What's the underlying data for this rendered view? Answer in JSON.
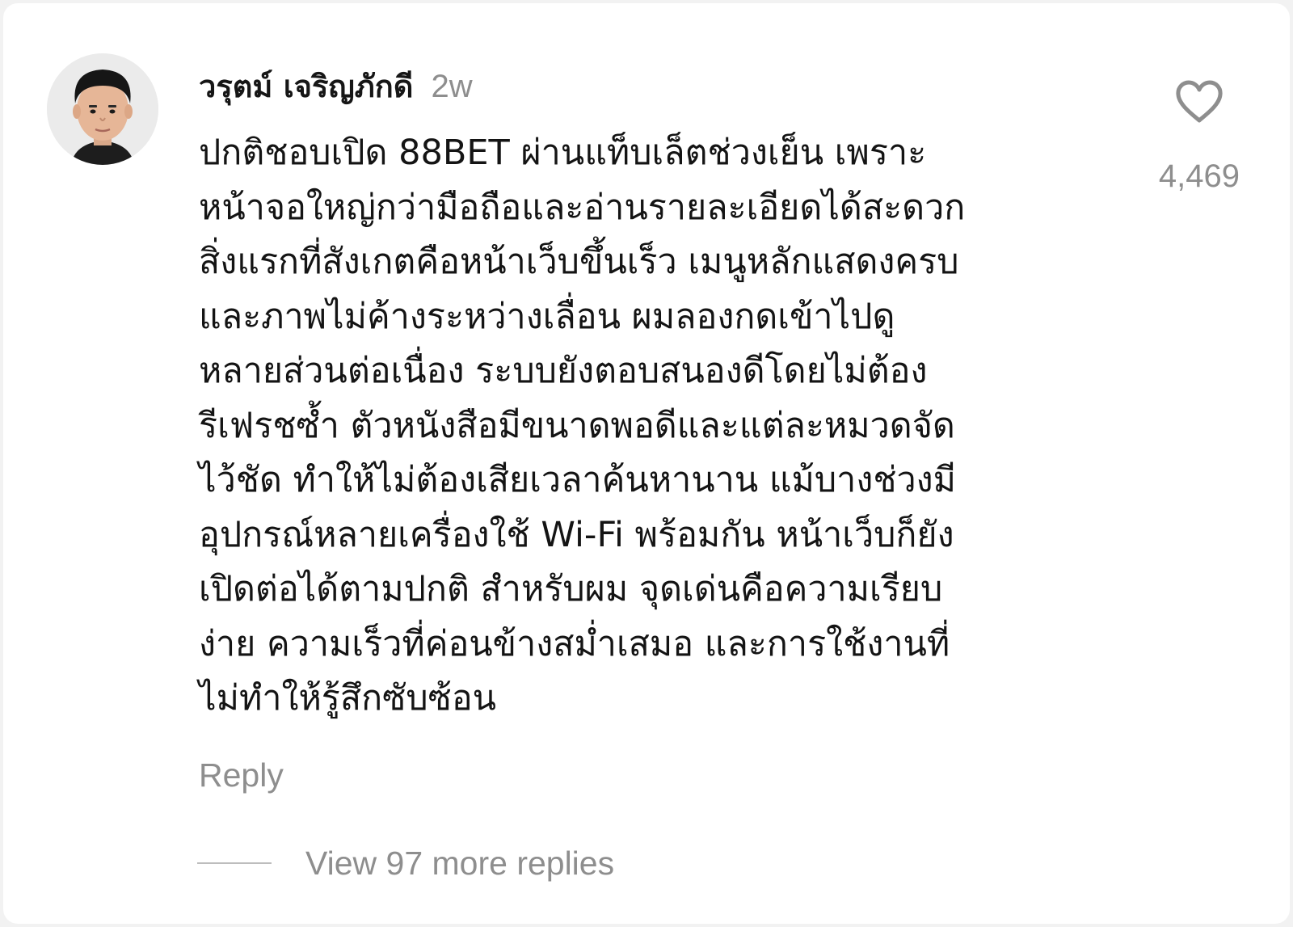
{
  "comment": {
    "username": "วรุตม์ เจริญภักดี",
    "time": "2w",
    "text_lines": [
      "ปกติชอบเปิด 88BET ผ่านแท็บเล็ตช่วงเย็น เพราะ",
      "หน้าจอใหญ่กว่ามือถือและอ่านรายละเอียดได้สะดวก",
      "สิ่งแรกที่สังเกตคือหน้าเว็บขึ้นเร็ว เมนูหลักแสดงครบ",
      "และภาพไม่ค้างระหว่างเลื่อน ผมลองกดเข้าไปดู",
      "หลายส่วนต่อเนื่อง ระบบยังตอบสนองดีโดยไม่ต้อง",
      "รีเฟรชซ้ำ ตัวหนังสือมีขนาดพอดีและแต่ละหมวดจัด",
      "ไว้ชัด ทำให้ไม่ต้องเสียเวลาค้นหานาน แม้บางช่วงมี",
      "อุปกรณ์หลายเครื่องใช้ Wi-Fi พร้อมกัน หน้าเว็บก็ยัง",
      "เปิดต่อได้ตามปกติ สำหรับผม จุดเด่นคือความเรียบ",
      "ง่าย ความเร็วที่ค่อนข้างสม่ำเสมอ และการใช้งานที่",
      "ไม่ทำให้รู้สึกซับซ้อน"
    ],
    "like_count": "4,469",
    "like_icon": "heart-outline-icon",
    "reply_label": "Reply",
    "view_replies_label": "View 97 more replies"
  },
  "colors": {
    "text": "#141414",
    "muted": "#8e8e8e",
    "background": "#ffffff"
  }
}
